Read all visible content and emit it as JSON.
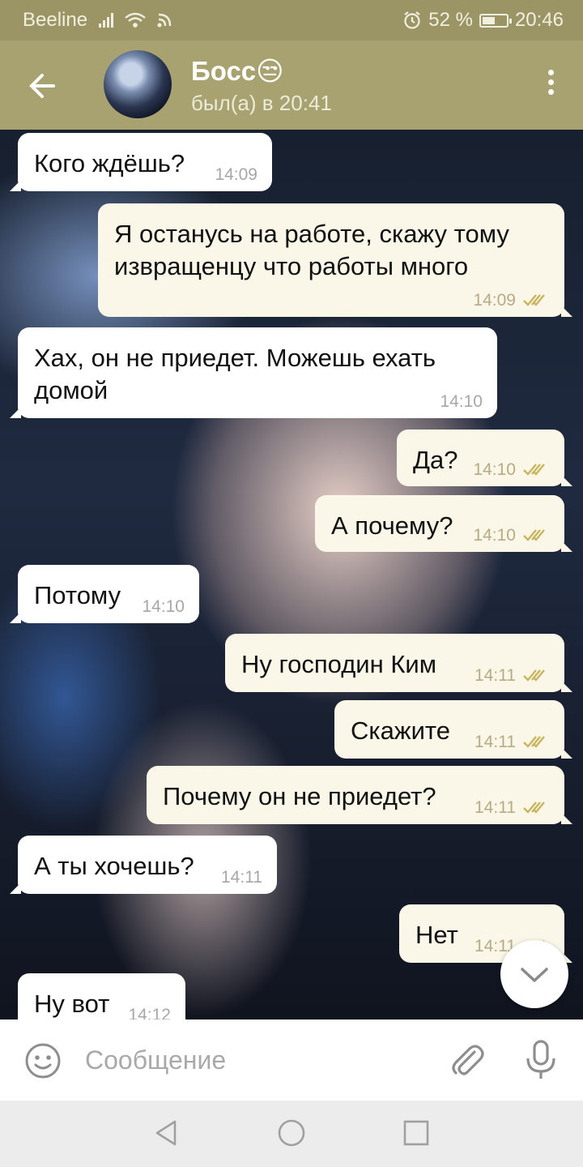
{
  "status_bar": {
    "carrier": "Beeline",
    "battery": "52 %",
    "battery_level": 0.52,
    "time": "20:46"
  },
  "header": {
    "title": "Босс😒",
    "subtitle": "был(а) в 20:41"
  },
  "messages": [
    {
      "side": "in",
      "text": "Кого ждёшь?",
      "time": "14:09"
    },
    {
      "side": "out",
      "text": "Я останусь на работе, скажу тому\nизвращенцу что работы много",
      "time": "14:09"
    },
    {
      "side": "in",
      "text": "Хах, он не приедет. Можешь ехать\nдомой",
      "time": "14:10"
    },
    {
      "side": "out",
      "text": "Да?",
      "time": "14:10"
    },
    {
      "side": "out",
      "text": "А почему?",
      "time": "14:10"
    },
    {
      "side": "in",
      "text": "Потому",
      "time": "14:10"
    },
    {
      "side": "out",
      "text": "Ну господин Ким",
      "time": "14:11"
    },
    {
      "side": "out",
      "text": "Скажите",
      "time": "14:11"
    },
    {
      "side": "out",
      "text": "Почему он не приедет?",
      "time": "14:11"
    },
    {
      "side": "in",
      "text": "А ты хочешь?",
      "time": "14:11"
    },
    {
      "side": "out",
      "text": "Нет",
      "time": "14:11"
    },
    {
      "side": "in",
      "text": "Ну вот",
      "time": "14:12"
    }
  ],
  "input": {
    "placeholder": "Сообщение"
  },
  "icons": {
    "back": "arrow-left-icon",
    "menu": "more-vert-icon",
    "read": "double-check-icon",
    "scroll_down": "chevron-down-icon",
    "emoji": "smiley-icon",
    "attach": "paperclip-icon",
    "mic": "microphone-icon"
  },
  "colors": {
    "header": "#a8a271",
    "status_bar": "#9b9566",
    "outgoing_bubble": "#faf6e8",
    "incoming_bubble": "#ffffff",
    "check": "#c8b45a"
  }
}
